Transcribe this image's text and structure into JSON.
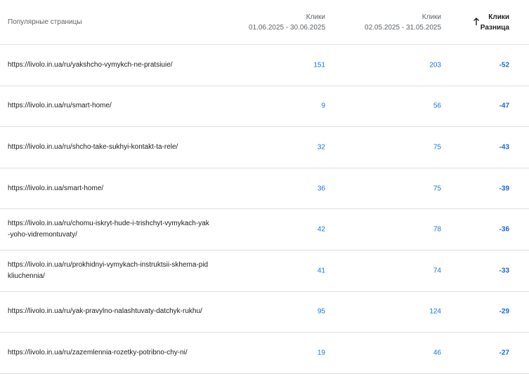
{
  "header": {
    "title": "Популярные страницы",
    "col1_label": "Клики",
    "col1_range": "01.06.2025 - 30.06.2025",
    "col2_label": "Клики",
    "col2_range": "02.05.2025 - 31.05.2025",
    "col3_label": "Клики",
    "col3_sub": "Разница",
    "sort_icon": "arrow-up-icon"
  },
  "rows": [
    {
      "url": "https://livolo.in.ua/ru/yakshcho-vymykch-ne-pratsiuie/",
      "current": "151",
      "previous": "203",
      "diff": "-52"
    },
    {
      "url": "https://livolo.in.ua/ru/smart-home/",
      "current": "9",
      "previous": "56",
      "diff": "-47"
    },
    {
      "url": "https://livolo.in.ua/ru/shcho-take-sukhyi-kontakt-ta-rele/",
      "current": "32",
      "previous": "75",
      "diff": "-43"
    },
    {
      "url": "https://livolo.in.ua/smart-home/",
      "current": "36",
      "previous": "75",
      "diff": "-39"
    },
    {
      "url": "https://livolo.in.ua/ru/chomu-iskryt-hude-i-trishchyt-vymykach-yak-yoho-vidremontuvaty/",
      "current": "42",
      "previous": "78",
      "diff": "-36"
    },
    {
      "url": "https://livolo.in.ua/ru/prokhidnyi-vymykach-instruktsii-skhema-pidkliuchennia/",
      "current": "41",
      "previous": "74",
      "diff": "-33"
    },
    {
      "url": "https://livolo.in.ua/ru/yak-pravylno-nalashtuvaty-datchyk-rukhu/",
      "current": "95",
      "previous": "124",
      "diff": "-29"
    },
    {
      "url": "https://livolo.in.ua/ru/zazemlennia-rozetky-potribno-chy-ni/",
      "current": "19",
      "previous": "46",
      "diff": "-27"
    }
  ]
}
